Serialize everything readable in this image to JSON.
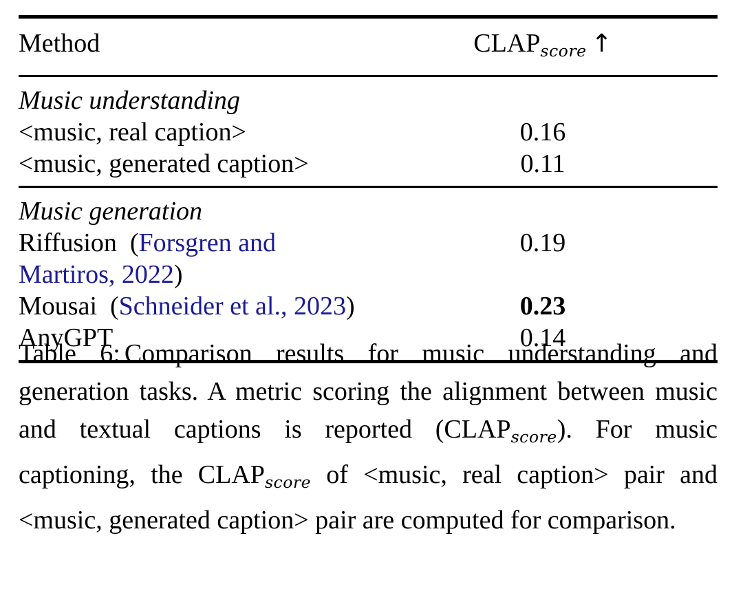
{
  "table": {
    "id": "Table 6",
    "columns": [
      {
        "key": "method",
        "label": "Method",
        "align": "left"
      },
      {
        "key": "score",
        "label_base": "CLAP",
        "label_sub": "score",
        "label_arrow": "↑",
        "align": "center"
      }
    ],
    "groups": [
      {
        "label": "Music understanding",
        "rows": [
          {
            "method": "<music, real caption>",
            "score": "0.16",
            "bold": false,
            "citation": null
          },
          {
            "method": "<music, generated caption>",
            "score": "0.11",
            "bold": false,
            "citation": null
          }
        ]
      },
      {
        "label": "Music generation",
        "rows": [
          {
            "method": "Riffusion",
            "score": "0.19",
            "bold": false,
            "citation": {
              "open": "(",
              "text": "Forsgren and Martiros, 2022",
              "close": ")"
            }
          },
          {
            "method": "Mousai",
            "score": "0.23",
            "bold": true,
            "citation": {
              "open": "(",
              "text": "Schneider et al., 2023",
              "close": ")"
            }
          },
          {
            "method": "AnyGPT",
            "score": "0.14",
            "bold": false,
            "citation": null
          }
        ]
      }
    ]
  },
  "caption": {
    "label": "Table 6:",
    "seg1": "Comparison results for music understanding and generation tasks. A metric scoring the alignment between music and textual captions is reported (CLAP",
    "sub1": "score",
    "seg2": "). For music captioning, the CLAP",
    "sub2": "score",
    "seg3": " of <music, real caption> pair and <music, generated caption> pair are computed for comparison."
  },
  "colors": {
    "text": "#000000",
    "citation_link": "#1c1c96",
    "rule": "#000000",
    "background": "#ffffff"
  }
}
